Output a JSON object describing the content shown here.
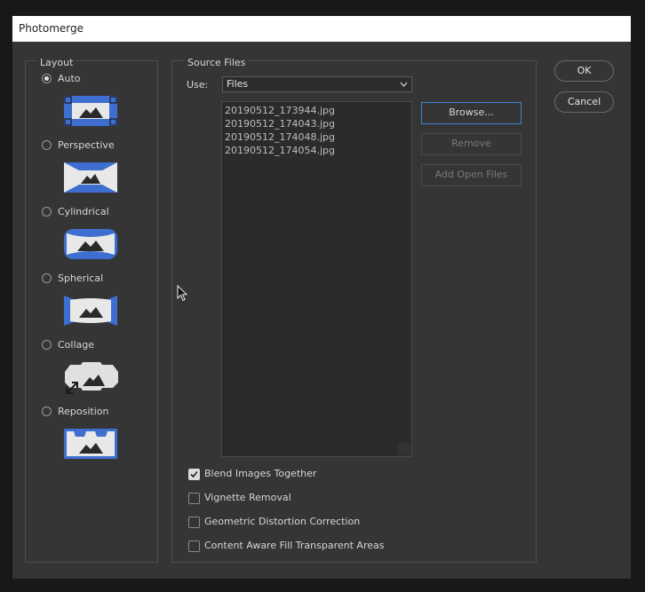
{
  "window": {
    "title": "Photomerge"
  },
  "layout": {
    "group_label": "Layout",
    "options": [
      {
        "label": "Auto",
        "selected": true,
        "icon": "auto-layout-icon"
      },
      {
        "label": "Perspective",
        "selected": false,
        "icon": "perspective-layout-icon"
      },
      {
        "label": "Cylindrical",
        "selected": false,
        "icon": "cylindrical-layout-icon"
      },
      {
        "label": "Spherical",
        "selected": false,
        "icon": "spherical-layout-icon"
      },
      {
        "label": "Collage",
        "selected": false,
        "icon": "collage-layout-icon"
      },
      {
        "label": "Reposition",
        "selected": false,
        "icon": "reposition-layout-icon"
      }
    ]
  },
  "source": {
    "group_label": "Source Files",
    "use_label": "Use:",
    "use_value": "Files",
    "files": [
      "20190512_173944.jpg",
      "20190512_174043.jpg",
      "20190512_174048.jpg",
      "20190512_174054.jpg"
    ],
    "browse_label": "Browse...",
    "remove_label": "Remove",
    "add_open_label": "Add Open Files"
  },
  "options": [
    {
      "label": "Blend Images Together",
      "checked": true
    },
    {
      "label": "Vignette Removal",
      "checked": false
    },
    {
      "label": "Geometric Distortion Correction",
      "checked": false
    },
    {
      "label": "Content Aware Fill Transparent Areas",
      "checked": false
    }
  ],
  "actions": {
    "ok_label": "OK",
    "cancel_label": "Cancel"
  },
  "colors": {
    "accent": "#3b86d6",
    "thumb_blue": "#3e6fd0",
    "background": "#353535"
  }
}
